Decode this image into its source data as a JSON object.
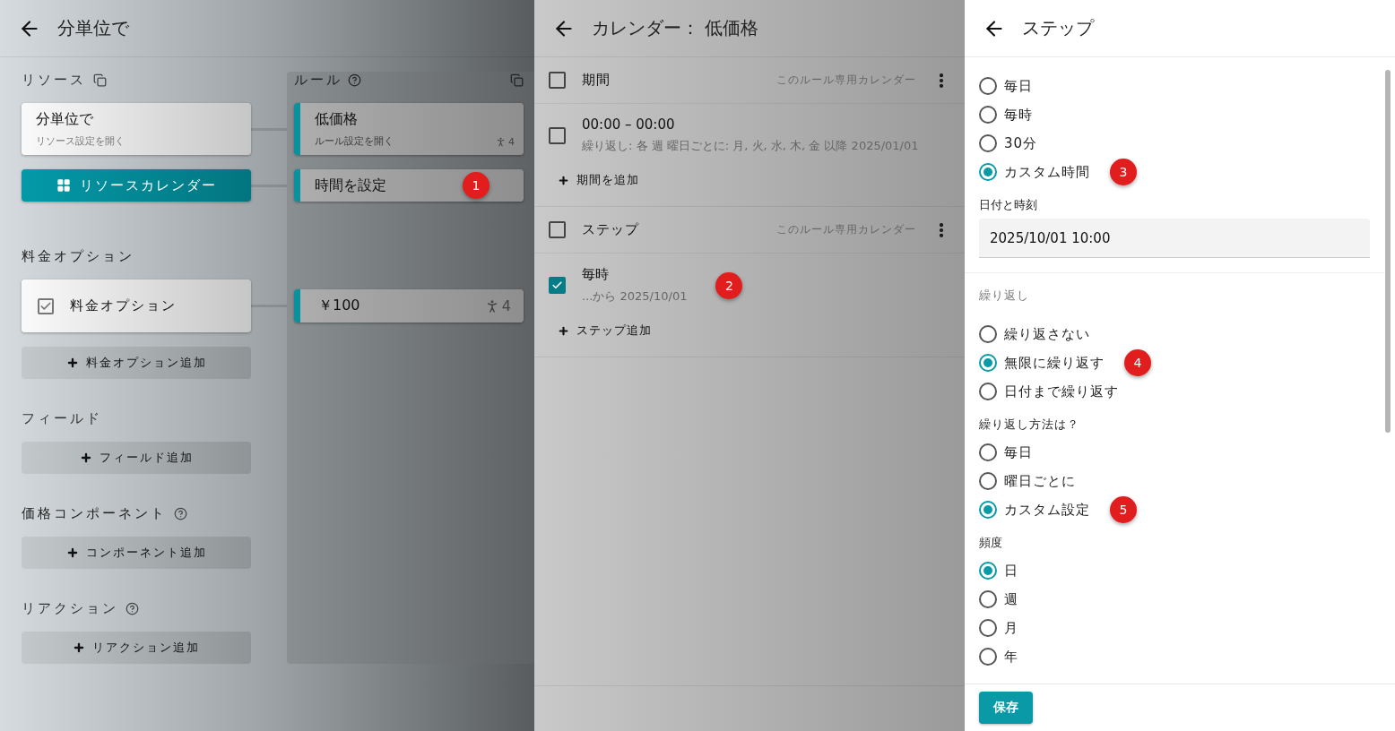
{
  "left_panel": {
    "title": "分単位で",
    "resources": {
      "heading": "リソース",
      "card": {
        "title": "分単位で",
        "subtitle": "リソース設定を開く"
      },
      "calendar_button": "リソースカレンダー"
    },
    "rules": {
      "heading": "ルール",
      "items": [
        {
          "kind": "rule",
          "title": "低価格",
          "subtitle": "ルール設定を開く",
          "count": "4"
        },
        {
          "kind": "time",
          "title": "時間を設定",
          "badge": "1"
        }
      ]
    },
    "pricing_options": {
      "heading": "料金オプション",
      "items": [
        {
          "label": "料金オプション",
          "checked": true,
          "rule": {
            "price": "￥100",
            "count": "4"
          }
        }
      ],
      "add_button": "料金オプション追加"
    },
    "sections": [
      {
        "heading": "フィールド",
        "help": false,
        "add_button": "フィールド追加"
      },
      {
        "heading": "価格コンポーネント",
        "help": true,
        "add_button": "コンポーネント追加"
      },
      {
        "heading": "リアクション",
        "help": true,
        "add_button": "リアクション追加"
      }
    ]
  },
  "calendar_panel": {
    "title": "カレンダー： 低価格",
    "sections": [
      {
        "title": "期間",
        "checked": false,
        "scope": "このルール専用カレンダー",
        "add_button": "期間を追加",
        "entries": [
          {
            "title": "00:00 – 00:00",
            "detail": "繰り返し: 各 週 曜日ごとに: 月, 火, 水, 木, 金 以降 2025/01/01",
            "checked": false
          }
        ]
      },
      {
        "title": "ステップ",
        "checked": false,
        "scope": "このルール専用カレンダー",
        "add_button": "ステップ追加",
        "entries": [
          {
            "title": "毎時",
            "detail": "...から 2025/10/01",
            "checked": true,
            "badge": "2"
          }
        ]
      }
    ]
  },
  "step_panel": {
    "title": "ステップ",
    "step_options": [
      {
        "label": "毎日",
        "selected": false
      },
      {
        "label": "毎時",
        "selected": false
      },
      {
        "label": "30分",
        "selected": false
      },
      {
        "label": "カスタム時間",
        "selected": true,
        "badge": "3"
      }
    ],
    "datetime": {
      "label": "日付と時刻",
      "value": "2025/10/01 10:00"
    },
    "repeat": {
      "heading": "繰り返し",
      "options": [
        {
          "label": "繰り返さない",
          "selected": false
        },
        {
          "label": "無限に繰り返す",
          "selected": true,
          "badge": "4"
        },
        {
          "label": "日付まで繰り返す",
          "selected": false
        }
      ]
    },
    "method": {
      "heading": "繰り返し方法は？",
      "options": [
        {
          "label": "毎日",
          "selected": false
        },
        {
          "label": "曜日ごとに",
          "selected": false
        },
        {
          "label": "カスタム設定",
          "selected": true,
          "badge": "5"
        }
      ]
    },
    "frequency": {
      "heading": "頻度",
      "options": [
        {
          "label": "日",
          "selected": true
        },
        {
          "label": "週",
          "selected": false
        },
        {
          "label": "月",
          "selected": false
        },
        {
          "label": "年",
          "selected": false
        }
      ]
    },
    "save_button": "保存"
  }
}
